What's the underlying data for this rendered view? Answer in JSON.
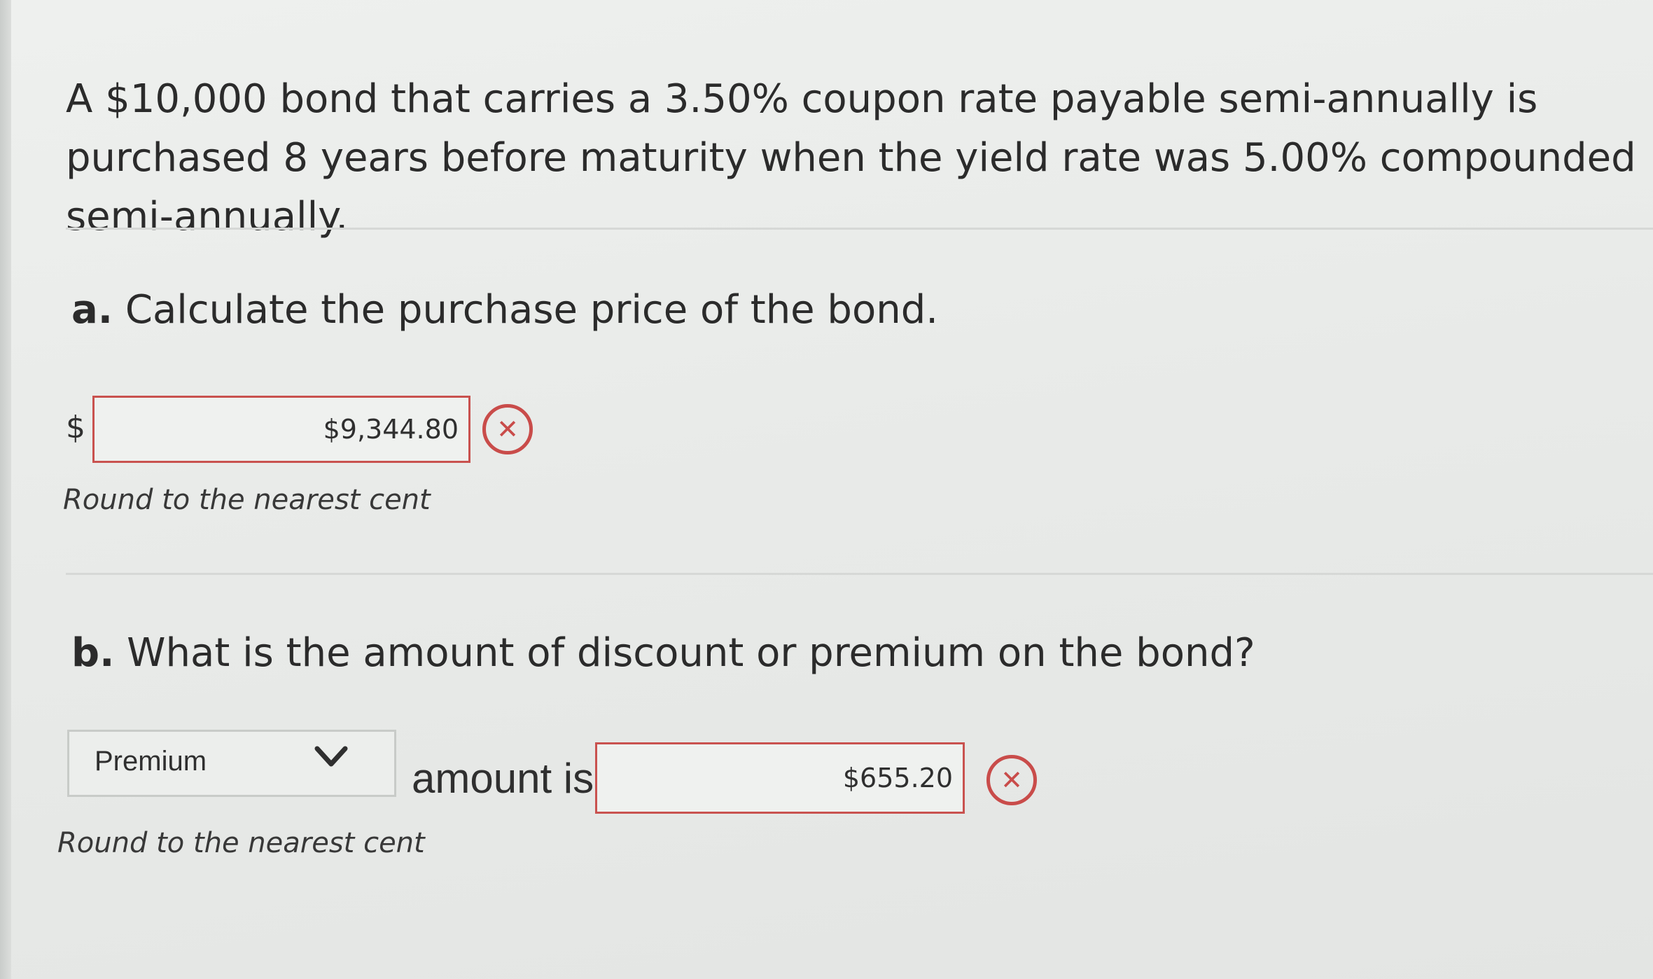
{
  "question": {
    "text": "A $10,000 bond that carries a 3.50% coupon rate payable semi-annually is purchased 8 years before maturity when the yield rate was 5.00% compounded semi-annually."
  },
  "part_a": {
    "letter": "a.",
    "title": "Calculate the purchase price of the bond.",
    "currency_symbol": "$",
    "answer_value": "$9,344.80",
    "status_icon": "incorrect-x-icon",
    "hint": "Round to the nearest cent"
  },
  "part_b": {
    "letter": "b.",
    "title": "What is the amount of discount or premium on the bond?",
    "select_value": "Premium",
    "amount_label": "amount is",
    "answer_value": "$655.20",
    "status_icon": "incorrect-x-icon",
    "hint": "Round to the nearest cent"
  },
  "icons": {
    "wrong_glyph": "✕",
    "dropdown_icon": "chevron-down-icon"
  },
  "colors": {
    "error": "#c94c4a",
    "background": "#ebedeb"
  }
}
